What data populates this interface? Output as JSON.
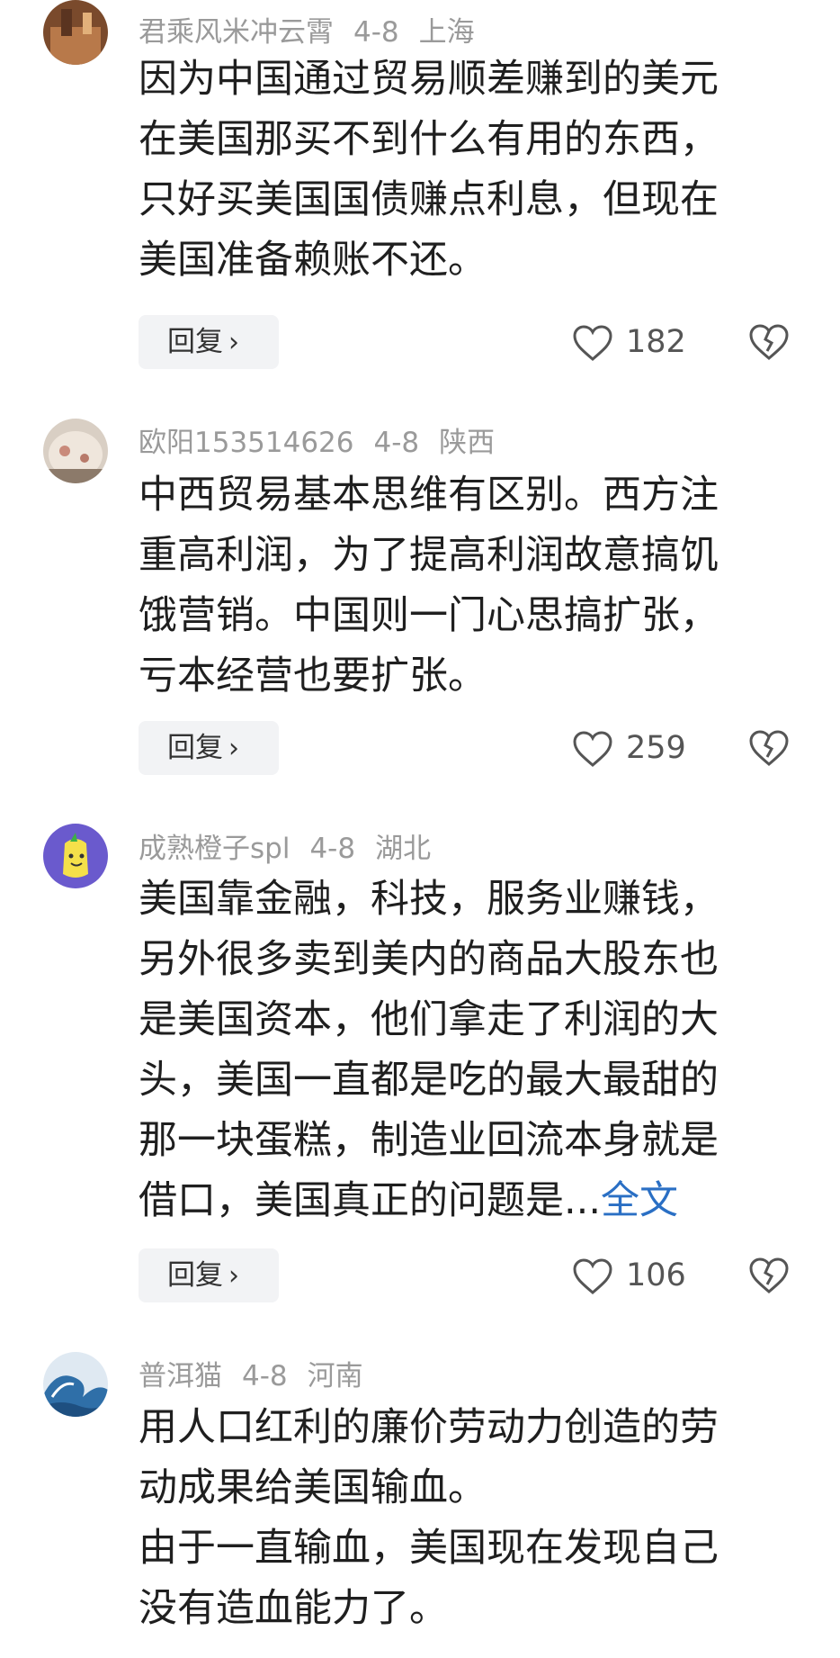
{
  "comments": [
    {
      "user": "君乘风米冲云霄",
      "date": "4-8",
      "location": "上海",
      "lines": [
        "因为中国通过贸易顺差赚到的美元",
        "在美国那买不到什么有用的东西，",
        "只好买美国国债赚点利息，但现在",
        "美国准备赖账不还。"
      ],
      "reply_label": "回复",
      "likes": "182"
    },
    {
      "user": "欧阳153514626",
      "date": "4-8",
      "location": "陕西",
      "lines": [
        "中西贸易基本思维有区别。西方注",
        "重高利润，为了提高利润故意搞饥",
        "饿营销。中国则一门心思搞扩张，",
        "亏本经营也要扩张。"
      ],
      "reply_label": "回复",
      "likes": "259"
    },
    {
      "user": "成熟橙子spl",
      "date": "4-8",
      "location": "湖北",
      "lines": [
        "美国靠金融，科技，服务业赚钱，",
        "另外很多卖到美内的商品大股东也",
        "是美国资本，他们拿走了利润的大",
        "头，美国一直都是吃的最大最甜的",
        "那一块蛋糕，制造业回流本身就是",
        "借口，美国真正的问题是..."
      ],
      "more_label": "全文",
      "reply_label": "回复",
      "likes": "106"
    },
    {
      "user": "普洱猫",
      "date": "4-8",
      "location": "河南",
      "lines": [
        "用人口红利的廉价劳动力创造的劳",
        "动成果给美国输血。",
        "由于一直输血，美国现在发现自己",
        "没有造血能力了。"
      ]
    }
  ],
  "icons": {
    "like": "heart-icon",
    "dislike": "broken-heart-icon",
    "reply_chevron": "chevron-right-icon"
  },
  "colors": {
    "link": "#2a6fc4",
    "meta": "#9a9a9a",
    "reply_bg": "#f2f3f5"
  }
}
